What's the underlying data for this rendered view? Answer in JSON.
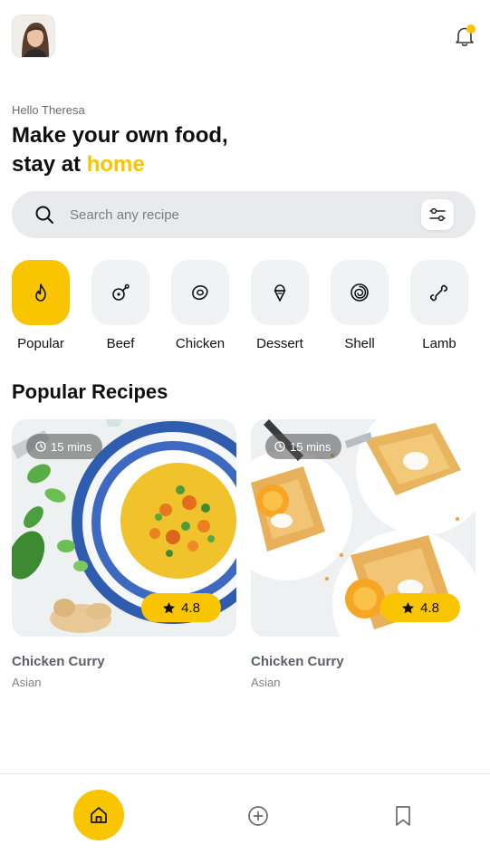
{
  "header": {
    "greeting": "Hello Theresa",
    "headline_line1": "Make your own food,",
    "headline_line2_prefix": "stay at ",
    "headline_accent": "home"
  },
  "search": {
    "placeholder": "Search any recipe"
  },
  "categories": [
    {
      "label": "Popular",
      "icon": "flame-icon",
      "active": true
    },
    {
      "label": "Beef",
      "icon": "drumstick-icon",
      "active": false
    },
    {
      "label": "Chicken",
      "icon": "steak-icon",
      "active": false
    },
    {
      "label": "Dessert",
      "icon": "ice-cream-icon",
      "active": false
    },
    {
      "label": "Shell",
      "icon": "spiral-shell-icon",
      "active": false
    },
    {
      "label": "Lamb",
      "icon": "bone-icon",
      "active": false
    }
  ],
  "section": {
    "title": "Popular Recipes"
  },
  "recipes": [
    {
      "title": "Chicken Curry",
      "subtitle": "Asian",
      "time": "15 mins",
      "rating": "4.8"
    },
    {
      "title": "Chicken Curry",
      "subtitle": "Asian",
      "time": "15 mins",
      "rating": "4.8"
    }
  ],
  "colors": {
    "accent": "#f8c500",
    "tile_bg": "#f1f2f4",
    "search_bg": "#e9eaec"
  },
  "nav": {
    "items": [
      "home-icon",
      "add-circle-icon",
      "bookmark-icon"
    ],
    "active": "home-icon"
  }
}
